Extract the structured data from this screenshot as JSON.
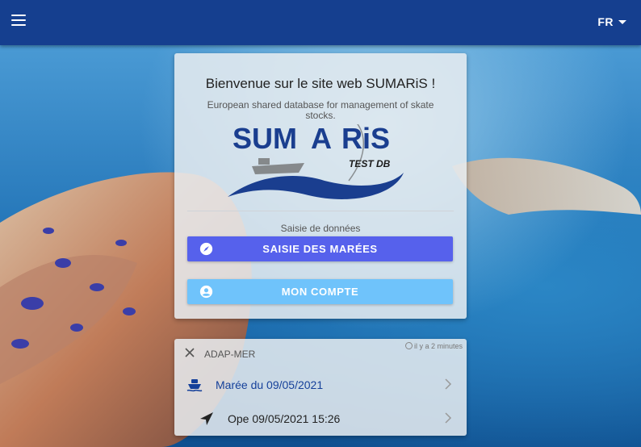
{
  "header": {
    "menu_icon": "hamburger-menu-icon",
    "language": "FR"
  },
  "welcome_card": {
    "title": "Bienvenue sur le site web SUMARiS !",
    "subtitle": "European shared database for management of skate stocks.",
    "logo": {
      "left": "SUM",
      "mid": "A",
      "right": "RiS",
      "tag": "TEST DB"
    },
    "section_label": "Saisie de données",
    "primary_button": {
      "label": "SAISIE DES MARÉES",
      "icon": "compass-icon"
    },
    "secondary_button": {
      "label": "MON COMPTE",
      "icon": "account-circle-icon"
    }
  },
  "recent_card": {
    "title": "ADAP-MER",
    "timestamp": "il y a 2 minutes",
    "items": [
      {
        "label": "Marée du 09/05/2021",
        "icon": "boat-icon"
      },
      {
        "label": "Ope 09/05/2021 15:26",
        "icon": "navigate-icon"
      }
    ]
  },
  "colors": {
    "toolbar": "#153f8f",
    "primary_button": "#5661ec",
    "secondary_button": "#6fc3fb",
    "link_text": "#15409a"
  }
}
